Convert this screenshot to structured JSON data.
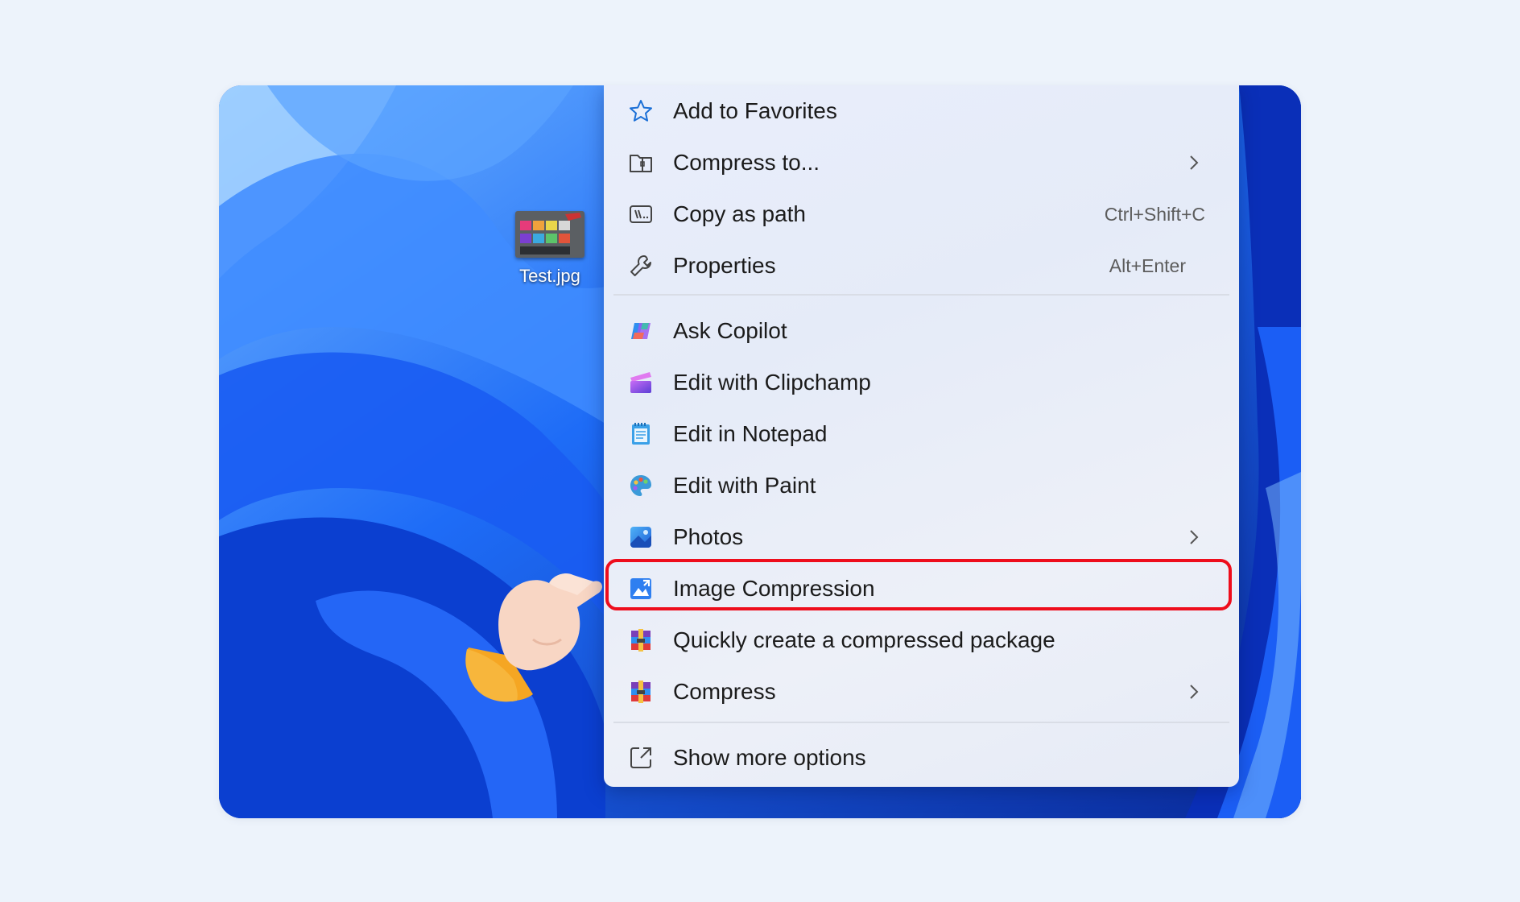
{
  "desktop": {
    "file_label": "Test.jpg"
  },
  "context_menu": {
    "items": [
      {
        "label": "Add to Favorites",
        "icon": "star-icon"
      },
      {
        "label": "Compress to...",
        "icon": "zip-folder-icon",
        "submenu": true
      },
      {
        "label": "Copy as path",
        "icon": "copy-path-icon",
        "shortcut": "Ctrl+Shift+C"
      },
      {
        "label": "Properties",
        "icon": "wrench-icon",
        "shortcut": "Alt+Enter"
      },
      {
        "label": "Ask Copilot",
        "icon": "copilot-icon"
      },
      {
        "label": "Edit with Clipchamp",
        "icon": "clipchamp-icon"
      },
      {
        "label": "Edit in Notepad",
        "icon": "notepad-icon"
      },
      {
        "label": "Edit with Paint",
        "icon": "paint-icon"
      },
      {
        "label": "Photos",
        "icon": "photos-icon",
        "submenu": true
      },
      {
        "label": "Image Compression",
        "icon": "image-compression-icon",
        "highlighted": true
      },
      {
        "label": "Quickly create a compressed package",
        "icon": "winrar-icon"
      },
      {
        "label": "Compress",
        "icon": "winrar-icon",
        "submenu": true
      },
      {
        "label": "Show more options",
        "icon": "show-more-icon"
      }
    ]
  },
  "colors": {
    "highlight_border": "#ee0d1c",
    "wallpaper_blue": "#1a5cf2",
    "menu_background": "#e9eefb"
  }
}
